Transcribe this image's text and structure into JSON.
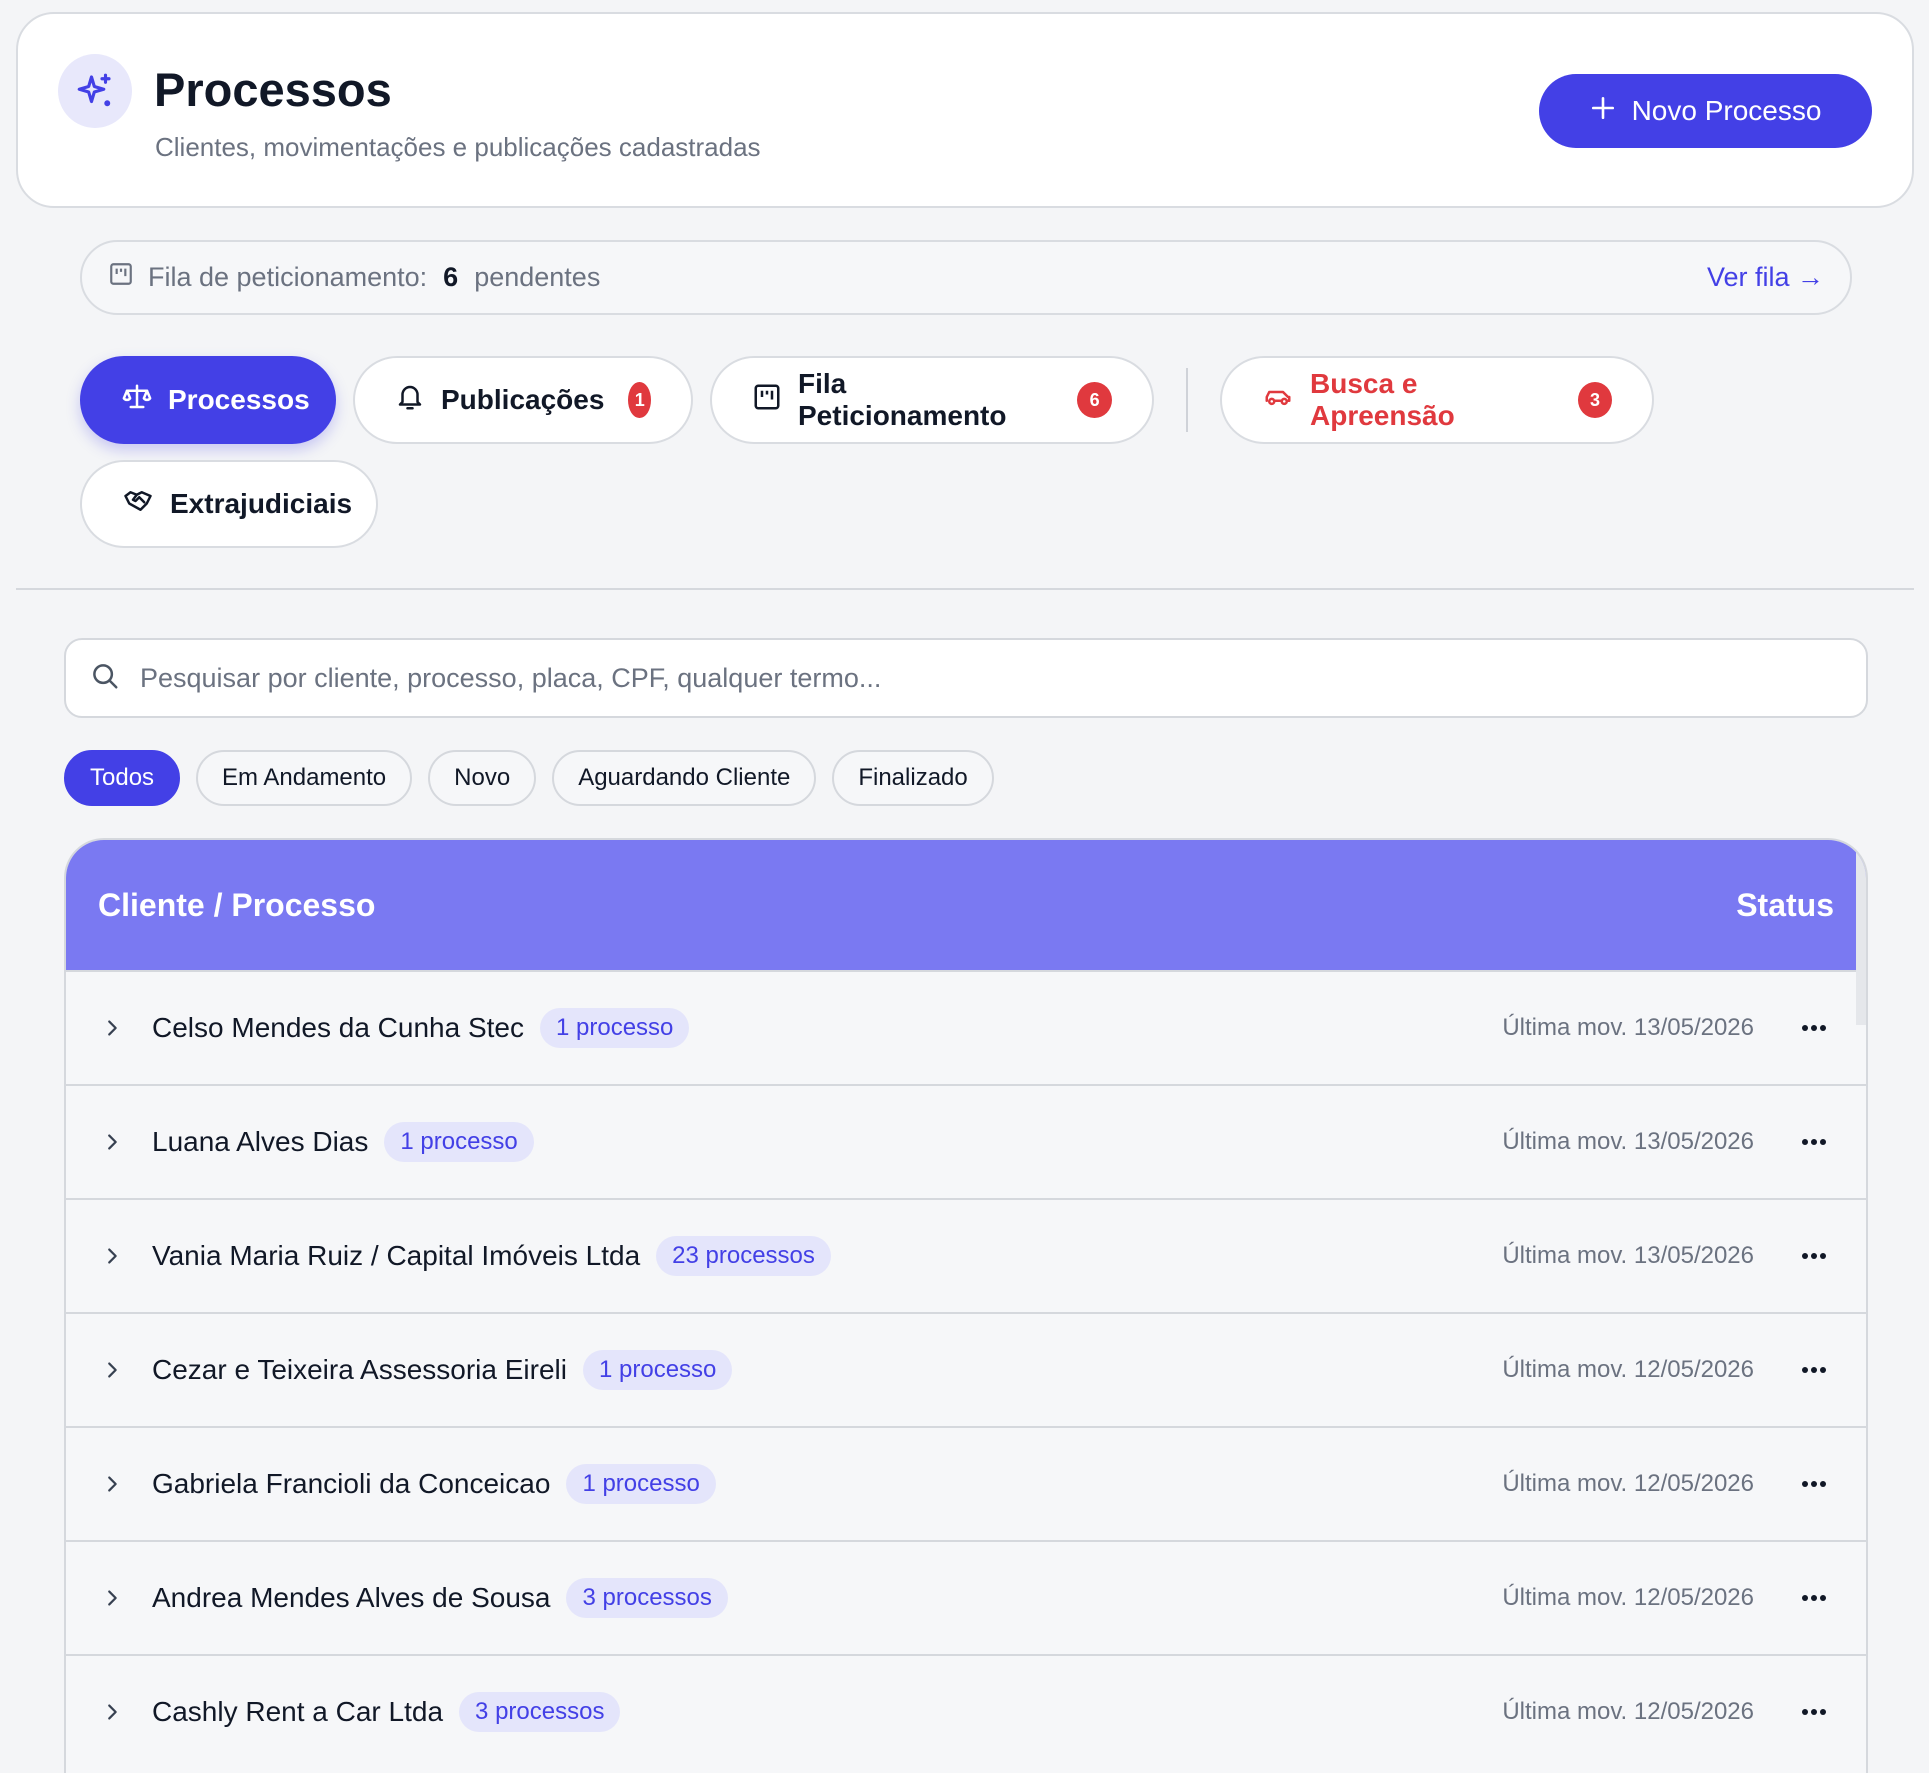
{
  "header": {
    "title": "Processos",
    "subtitle": "Clientes, movimentações e publicações cadastradas",
    "new_button": "Novo Processo",
    "logo_icon": "sparkles-icon"
  },
  "queue": {
    "label": "Fila de peticionamento:",
    "count": "6",
    "suffix": "pendentes",
    "link": "Ver fila →"
  },
  "tabs": [
    {
      "label": "Processos",
      "icon": "scale-icon",
      "active": true
    },
    {
      "label": "Publicações",
      "icon": "bell-icon",
      "badge": "1"
    },
    {
      "label": "Fila Peticionamento",
      "icon": "queue-icon",
      "badge": "6"
    },
    {
      "label": "Busca e Apreensão",
      "icon": "car-icon",
      "badge": "3",
      "danger": true
    },
    {
      "label": "Extrajudiciais",
      "icon": "handshake-icon"
    }
  ],
  "search": {
    "placeholder": "Pesquisar por cliente, processo, placa, CPF, qualquer termo..."
  },
  "filters": [
    "Todos",
    "Em Andamento",
    "Novo",
    "Aguardando Cliente",
    "Finalizado"
  ],
  "table": {
    "col_client": "Cliente / Processo",
    "col_status": "Status",
    "rows": [
      {
        "name": "Celso Mendes da Cunha Stec",
        "count": "1 processo",
        "mov": "Última mov. 13/05/2026"
      },
      {
        "name": "Luana Alves Dias",
        "count": "1 processo",
        "mov": "Última mov. 13/05/2026"
      },
      {
        "name": "Vania Maria Ruiz / Capital Imóveis Ltda",
        "count": "23 processos",
        "mov": "Última mov. 13/05/2026"
      },
      {
        "name": "Cezar e Teixeira Assessoria Eireli",
        "count": "1 processo",
        "mov": "Última mov. 12/05/2026"
      },
      {
        "name": "Gabriela Francioli da Conceicao",
        "count": "1 processo",
        "mov": "Última mov. 12/05/2026"
      },
      {
        "name": "Andrea Mendes Alves de Sousa",
        "count": "3 processos",
        "mov": "Última mov. 12/05/2026"
      },
      {
        "name": "Cashly Rent a Car Ltda",
        "count": "3 processos",
        "mov": "Última mov. 12/05/2026"
      }
    ]
  },
  "colors": {
    "accent": "#4340e6",
    "header_bg": "#7a79f2",
    "danger": "#e0393e"
  }
}
